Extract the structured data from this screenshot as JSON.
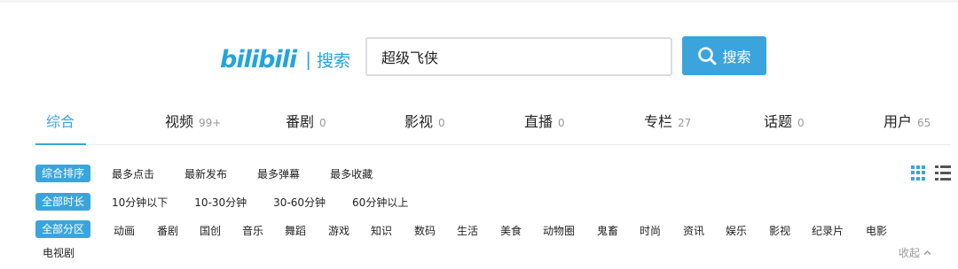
{
  "header": {
    "logo": "bilibili",
    "logo_separator": "|",
    "logo_subtitle": "搜索",
    "search_value": "超级飞侠",
    "search_button_label": "搜索"
  },
  "tabs": [
    {
      "label": "综合",
      "count": ""
    },
    {
      "label": "视频",
      "count": "99+"
    },
    {
      "label": "番剧",
      "count": "0"
    },
    {
      "label": "影视",
      "count": "0"
    },
    {
      "label": "直播",
      "count": "0"
    },
    {
      "label": "专栏",
      "count": "27"
    },
    {
      "label": "话题",
      "count": "0"
    },
    {
      "label": "用户",
      "count": "65"
    }
  ],
  "order_filter": {
    "active": "综合排序",
    "options": [
      "最多点击",
      "最新发布",
      "最多弹幕",
      "最多收藏"
    ]
  },
  "duration_filter": {
    "active": "全部时长",
    "options": [
      "10分钟以下",
      "10-30分钟",
      "30-60分钟",
      "60分钟以上"
    ]
  },
  "category_filter": {
    "active": "全部分区",
    "options": [
      "动画",
      "番剧",
      "国创",
      "音乐",
      "舞蹈",
      "游戏",
      "知识",
      "数码",
      "生活",
      "美食",
      "动物圈",
      "鬼畜",
      "时尚",
      "资讯",
      "娱乐",
      "影视",
      "纪录片",
      "电影",
      "电视剧"
    ]
  },
  "collapse_label": "收起",
  "colors": {
    "accent": "#3ba4dc",
    "logo": "#24a4dd",
    "muted": "#999999"
  },
  "icons": {
    "search": "magnifier-icon",
    "grid_view": "grid-view-icon",
    "list_view": "list-view-icon",
    "collapse": "chevron-up-icon"
  }
}
